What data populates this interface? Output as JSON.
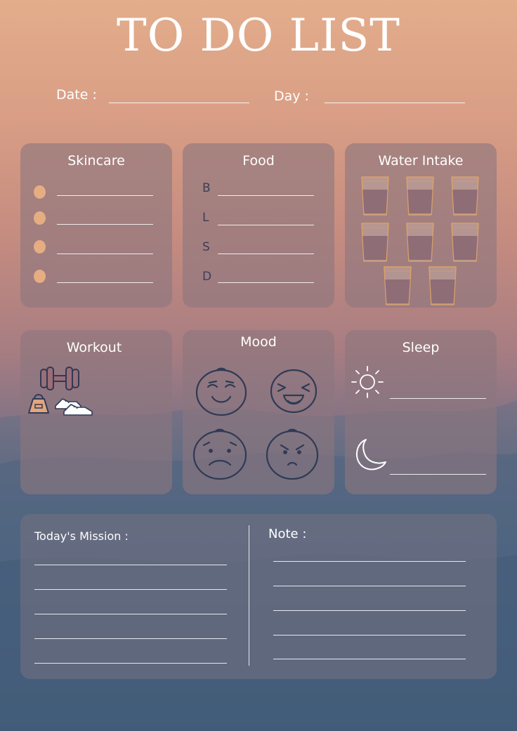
{
  "title": "TO DO LIST",
  "header": {
    "date_label": "Date :",
    "day_label": "Day :"
  },
  "cards": {
    "skincare": {
      "title": "Skincare"
    },
    "food": {
      "title": "Food",
      "meals": [
        "B",
        "L",
        "S",
        "D"
      ]
    },
    "water": {
      "title": "Water Intake",
      "glass_count": 8
    },
    "workout": {
      "title": "Workout",
      "icons": [
        "dumbbell-icon",
        "kettlebell-icon",
        "sneaker-icon"
      ]
    },
    "mood": {
      "title": "Mood",
      "faces": [
        "happy-face-icon",
        "laughing-face-icon",
        "sad-face-icon",
        "angry-face-icon"
      ]
    },
    "sleep": {
      "title": "Sleep",
      "icons": [
        "sun-icon",
        "moon-icon"
      ]
    },
    "mission": {
      "label": "Today's Mission :"
    },
    "note": {
      "label": "Note :"
    }
  },
  "colors": {
    "bg_top": "#e3ad8b",
    "bg_bottom": "#3f5a75",
    "card_fill": "#8c767e",
    "dot": "#e6ad83",
    "glass_water": "#8f6d76",
    "glass_outline": "#d9a06a",
    "icon_ink": "#2f3a55"
  }
}
